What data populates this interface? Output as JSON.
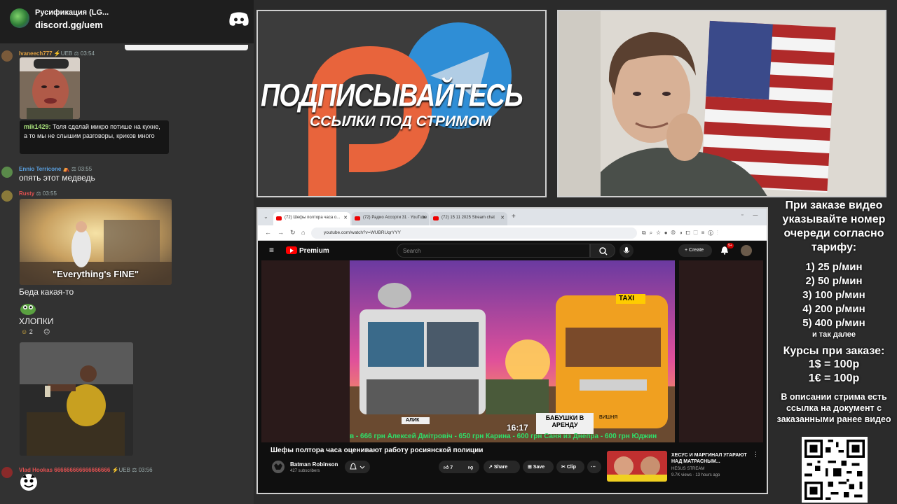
{
  "discord": {
    "server_title": "Русификация (LG...",
    "invite_link": "discord.gg/uem"
  },
  "chat": {
    "messages": [
      {
        "user": "Ivaneech777",
        "badges": "⚡UEB ⚖",
        "time": "03:54"
      },
      {
        "reply_user": "mik1429:",
        "reply_text": "Толя сделай микро потише на кухне, а то мы не слышим разговоры, криков много"
      },
      {
        "user": "Ennio Terricone",
        "badges": "⛺ ⚖",
        "time": "03:55",
        "text": "опять этот медведь"
      },
      {
        "user": "Rusty",
        "badges": "⚖",
        "time": "03:55",
        "image_caption": "\"Everything's FINE\"",
        "text": "Беда какая-то"
      },
      {
        "text": "ХЛОПКИ",
        "reactions": [
          {
            "emoji": "☺",
            "count": "2"
          },
          {
            "emoji": "☹",
            "count": ""
          }
        ]
      },
      {
        "user": "Vlad Hookas 666666666666666666",
        "badges": "⚡UEB ⚖",
        "time": "03:56"
      }
    ]
  },
  "promo": {
    "title": "ПОДПИСЫВАЙТЕСЬ",
    "subtitle": "ССЫЛКИ ПОД СТРИМОМ"
  },
  "browser": {
    "tabs": [
      {
        "label": "(72) Шефы полтора часа о...",
        "active": true
      },
      {
        "label": "(72) Радио Ассорти 31 · YouTube",
        "active": false
      },
      {
        "label": "(72) 15 11 2025 Stream chat",
        "active": false
      }
    ],
    "url": "youtube.com/watch?v=WUBRUqrYYY"
  },
  "youtube": {
    "brand": "Premium",
    "search_placeholder": "Search",
    "create_label": "Create",
    "notif_count": "9+",
    "video": {
      "timestamp": "16:17",
      "ticker": "в - 666 грн   Алексей Дмітровіч - 650 грн   Карина - 600 грн   Саня из Днепра - 600 грн   Юджин",
      "overlay_sign": "БАБУШКИ В АРЕНДУ",
      "taxi_sign": "TAXI",
      "name_tag": "АЛИК",
      "plate": "ВИШНЯ"
    },
    "title": "Шефы полтора часа оценивают работу росиянской полиции",
    "channel": "Batman Robinson",
    "subscribers": "427 subscribers",
    "likes": "7",
    "share_label": "Share",
    "save_label": "Save",
    "clip_label": "Clip",
    "recommended": {
      "title": "ХЕСУС И МАРГИНАЛ УГАРАЮТ НАД МАТРАСНЫМ...",
      "channel": "HESUS STREAM",
      "meta": "9.7K views · 13 hours ago"
    }
  },
  "info_panel": {
    "heading": "При заказе видео указывайте номер очереди согласно тарифу:",
    "tariffs": [
      "1) 25 р/мин",
      "2) 50 р/мин",
      "3) 100 р/мин",
      "4) 200 р/мин",
      "5) 400 р/мин"
    ],
    "tariffs_more": "и так далее",
    "rates_heading": "Курсы при заказе:",
    "rates": [
      "1$ = 100р",
      "1€ = 100р"
    ],
    "note": "В описании стрима есть ссылка на документ с заказанными ранее видео"
  }
}
